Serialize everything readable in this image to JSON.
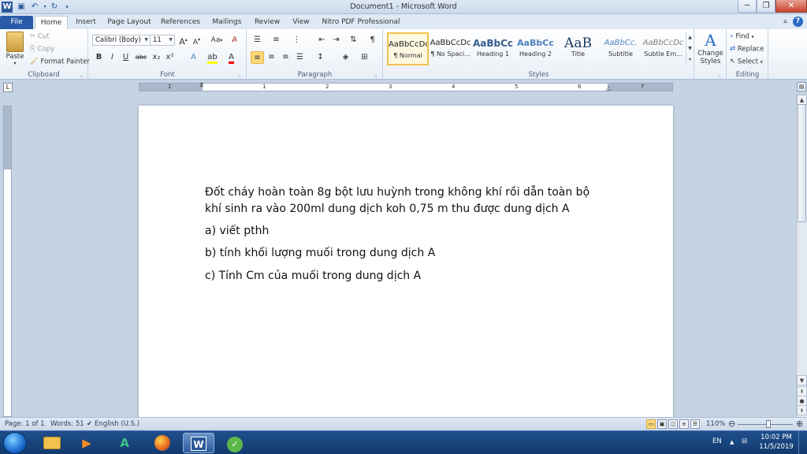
{
  "window": {
    "title": "Document1 - Microsoft Word",
    "buttons": {
      "minimize": "─",
      "maximize": "❐",
      "close": "✕"
    }
  },
  "tabs": [
    {
      "label": "File"
    },
    {
      "label": "Home"
    },
    {
      "label": "Insert"
    },
    {
      "label": "Page Layout"
    },
    {
      "label": "References"
    },
    {
      "label": "Mailings"
    },
    {
      "label": "Review"
    },
    {
      "label": "View"
    },
    {
      "label": "Nitro PDF Professional"
    }
  ],
  "ribbon": {
    "clipboard": {
      "label": "Clipboard",
      "paste": "Paste",
      "cut": "Cut",
      "copy": "Copy",
      "format_painter": "Format Painter"
    },
    "font": {
      "label": "Font",
      "font_name": "Calibri (Body)",
      "font_size": "11",
      "grow": "A",
      "shrink": "A",
      "change_case": "Aa",
      "bold": "B",
      "italic": "I",
      "underline": "U",
      "strikethrough": "abc",
      "subscript": "x₂",
      "superscript": "x²"
    },
    "paragraph": {
      "label": "Paragraph",
      "show_marks": "¶"
    },
    "styles": {
      "label": "Styles",
      "items": [
        {
          "preview": "AaBbCcDc",
          "name": "¶ Normal"
        },
        {
          "preview": "AaBbCcDc",
          "name": "¶ No Spaci..."
        },
        {
          "preview": "AaBbCc",
          "name": "Heading 1"
        },
        {
          "preview": "AaBbCc",
          "name": "Heading 2"
        },
        {
          "preview": "AaB",
          "name": "Title"
        },
        {
          "preview": "AaBbCc.",
          "name": "Subtitle"
        },
        {
          "preview": "AaBbCcDc",
          "name": "Subtle Em..."
        }
      ],
      "change_styles": "Change Styles"
    },
    "editing": {
      "label": "Editing",
      "find": "Find",
      "replace": "Replace",
      "select": "Select"
    }
  },
  "ruler": {
    "numbers": [
      "1",
      "1",
      "2",
      "3",
      "4",
      "5",
      "6",
      "7"
    ]
  },
  "document": {
    "paragraphs": [
      "Đốt cháy hoàn toàn 8g bột lưu huỳnh trong không khí rồi dẫn toàn bộ khí sinh ra vào 200ml dung dịch koh 0,75 m thu được dung dịch A",
      "a) viết pthh",
      "b) tính khối lượng muối trong dung dịch A",
      "c) Tính Cm của muối trong dung dịch A"
    ]
  },
  "status": {
    "page": "Page: 1 of 1",
    "words": "Words: 51",
    "language": "English (U.S.)",
    "zoom": "110%",
    "zoom_fraction": 0.55
  },
  "taskbar": {
    "language": "EN",
    "time": "10:02 PM",
    "date": "11/5/2019"
  },
  "colors": {
    "file_tab": "#2a5ba8",
    "selected_style_border": "#f5c14b",
    "taskbar": "#1f4f8c"
  }
}
